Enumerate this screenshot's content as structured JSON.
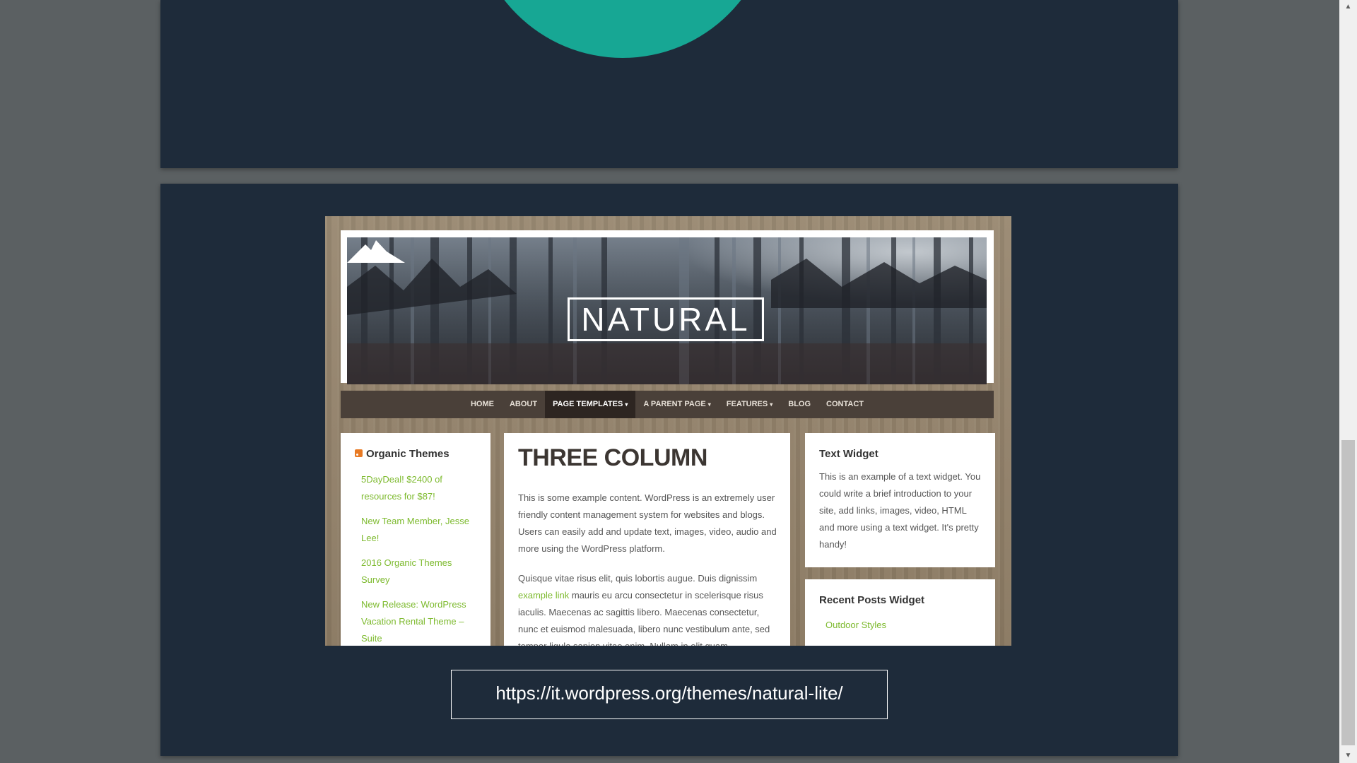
{
  "screenshot": {
    "logo_text": "NATURAL",
    "nav": [
      {
        "label": "HOME"
      },
      {
        "label": "ABOUT"
      },
      {
        "label": "PAGE TEMPLATES",
        "caret": "▾",
        "active": true
      },
      {
        "label": "A PARENT PAGE",
        "caret": "▾"
      },
      {
        "label": "FEATURES",
        "caret": "▾"
      },
      {
        "label": "BLOG"
      },
      {
        "label": "CONTACT"
      }
    ],
    "left_widget": {
      "title": "Organic Themes",
      "items": [
        "5DayDeal! $2400 of resources for $87!",
        "New Team Member, Jesse Lee!",
        "2016 Organic Themes Survey",
        "New Release: WordPress Vacation Rental Theme – Suite"
      ]
    },
    "main": {
      "title": "THREE COLUMN",
      "para1": "This is some example content. WordPress is an extremely user friendly content management system for websites and blogs. Users can easily add and update text, images, video, audio and more using the WordPress platform.",
      "para2_before": "Quisque vitae risus elit, quis lobortis augue. Duis dignissim ",
      "para2_link": "example link",
      "para2_after": " mauris eu arcu consectetur in scelerisque risus iaculis. Maecenas ac sagittis libero. Maecenas consectetur, nunc et euismod malesuada, libero nunc vestibulum ante, sed tempor ligula sapien vitae enim. Nullam in elit quam."
    },
    "text_widget": {
      "title": "Text Widget",
      "body": "This is an example of a text widget. You could write a brief introduction to your site, add links, images, video, HTML and more using a text widget. It's pretty handy!"
    },
    "recent_posts": {
      "title": "Recent Posts Widget",
      "items": [
        "Outdoor Styles"
      ]
    }
  },
  "url_caption": "https://it.wordpress.org/themes/natural-lite/",
  "scrollbar": {
    "up_icon": "▲",
    "down_icon": "▼"
  },
  "colors": {
    "page_bg": "#5b6062",
    "slide_bg": "#1e2b3a",
    "accent_teal": "#17a794",
    "link_green": "#7dba2e",
    "nav_bg": "#4a4039"
  }
}
